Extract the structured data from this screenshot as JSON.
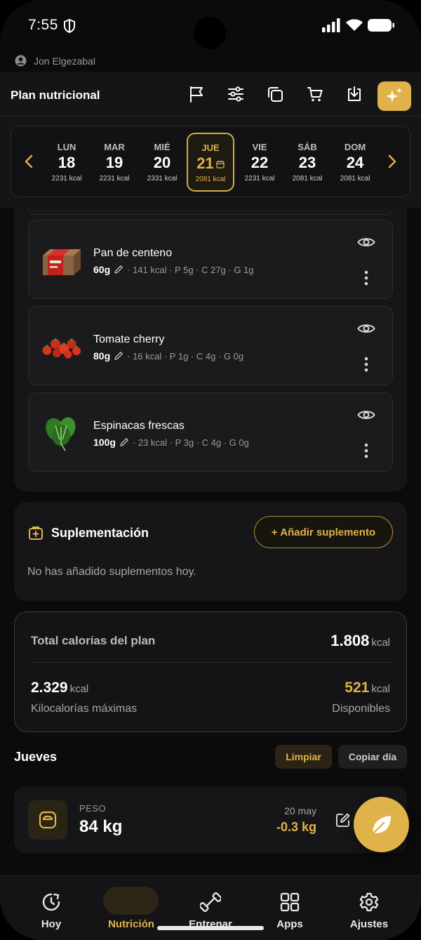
{
  "status_bar": {
    "time": "7:55"
  },
  "user": {
    "name": "Jon Elgezabal"
  },
  "header": {
    "title": "Plan nutricional"
  },
  "week": [
    {
      "name": "LUN",
      "num": "18",
      "kcal": "2231 kcal"
    },
    {
      "name": "MAR",
      "num": "19",
      "kcal": "2231 kcal"
    },
    {
      "name": "MIÉ",
      "num": "20",
      "kcal": "2331 kcal"
    },
    {
      "name": "JUE",
      "num": "21",
      "kcal": "2081 kcal",
      "selected": true
    },
    {
      "name": "VIE",
      "num": "22",
      "kcal": "2231 kcal"
    },
    {
      "name": "SÁB",
      "num": "23",
      "kcal": "2081 kcal"
    },
    {
      "name": "DOM",
      "num": "24",
      "kcal": "2081 kcal"
    }
  ],
  "foods": [
    {
      "name": "Pan de centeno",
      "grams": "60g",
      "macros": "· 141 kcal · P 5g · C 27g · G 1g"
    },
    {
      "name": "Tomate cherry",
      "grams": "80g",
      "macros": "· 16 kcal · P 1g · C 4g · G 0g"
    },
    {
      "name": "Espinacas frescas",
      "grams": "100g",
      "macros": "· 23 kcal · P 3g · C 4g · G 0g"
    }
  ],
  "supplements": {
    "title": "Suplementación",
    "add_label": "+ Añadir suplemento",
    "empty_text": "No has añadido suplementos hoy."
  },
  "totals": {
    "plan_label": "Total calorías del plan",
    "plan_value": "1.808",
    "max_value": "2.329",
    "max_label": "Kilocalorías máximas",
    "available_value": "521",
    "available_label": "Disponibles",
    "unit": "kcal"
  },
  "day_section": {
    "title": "Jueves",
    "clear_label": "Limpiar",
    "copy_label": "Copiar día"
  },
  "weight": {
    "label": "PESO",
    "value": "84 kg",
    "date": "20 may",
    "delta": "-0.3 kg"
  },
  "nav": [
    {
      "label": "Hoy",
      "icon": "clock-icon"
    },
    {
      "label": "Nutrición",
      "icon": "calendar-icon",
      "active": true
    },
    {
      "label": "Entrenar",
      "icon": "dumbbell-icon"
    },
    {
      "label": "Apps",
      "icon": "grid-icon"
    },
    {
      "label": "Ajustes",
      "icon": "gear-icon"
    }
  ],
  "colors": {
    "accent": "#e0b24a",
    "background": "#0b0b0c",
    "card": "#1b1b1d"
  }
}
